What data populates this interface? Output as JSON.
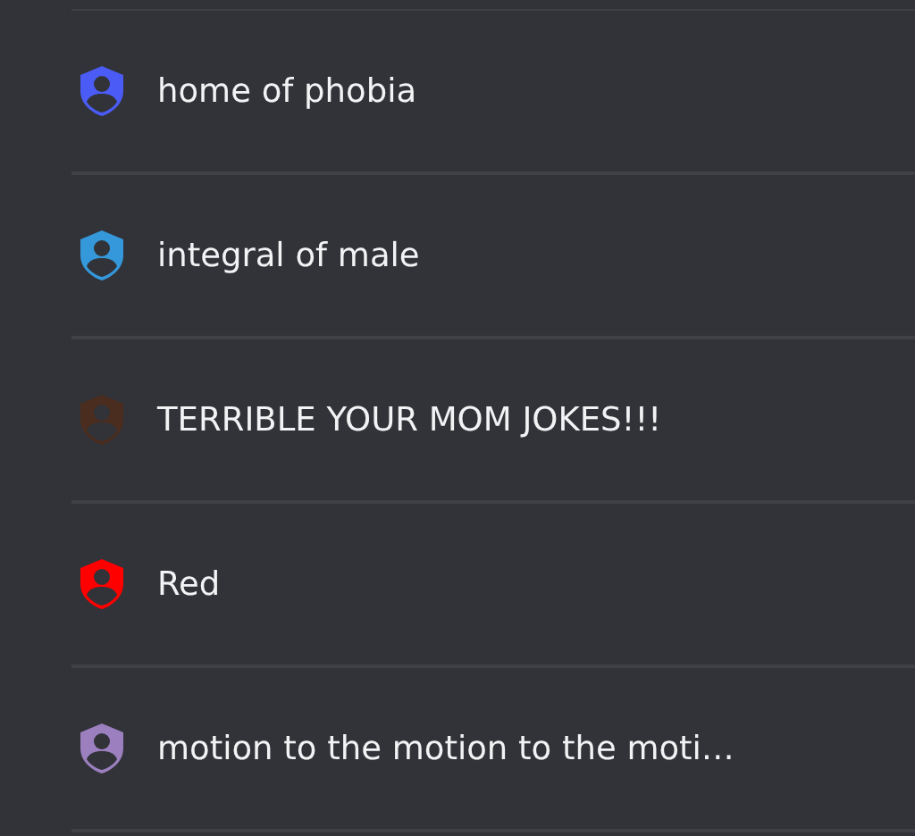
{
  "roles": [
    {
      "name": "home of phobia",
      "color": "#4b5cf6"
    },
    {
      "name": "integral of male",
      "color": "#3498db"
    },
    {
      "name": "TERRIBLE YOUR MOM JOKES!!!",
      "color": "#4a2d1e"
    },
    {
      "name": "Red",
      "color": "#ff0000"
    },
    {
      "name": "motion to the motion to the moti…",
      "color": "#9c7fbf"
    }
  ]
}
